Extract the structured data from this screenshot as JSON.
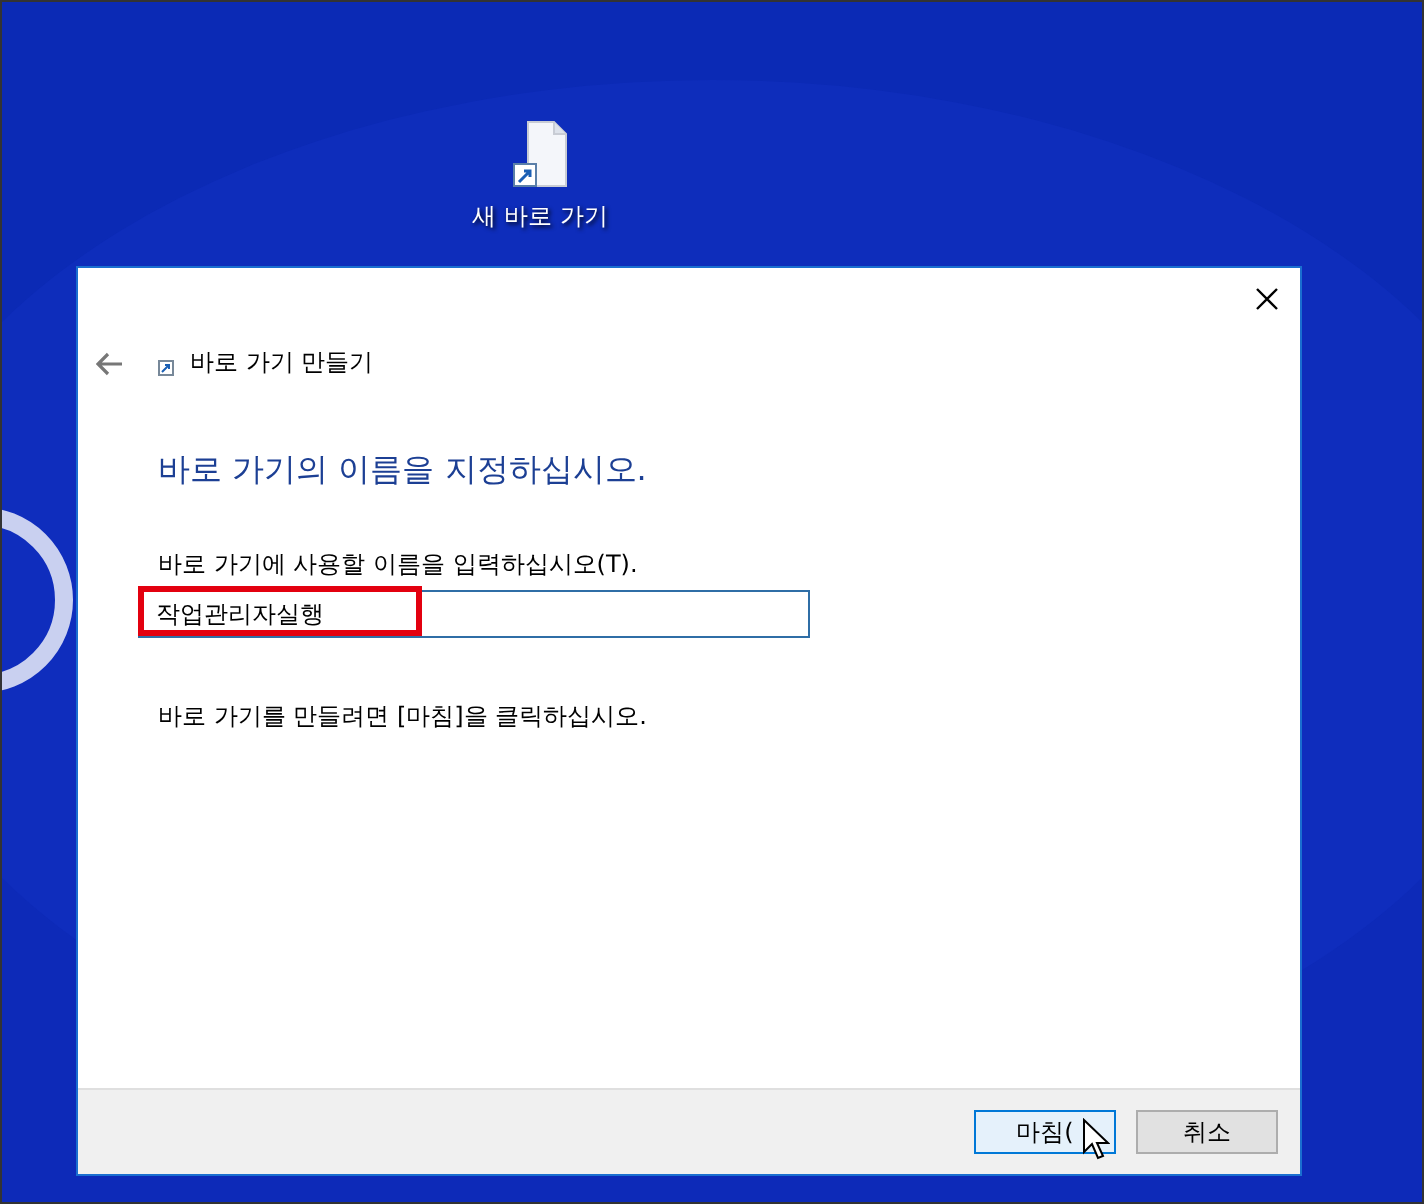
{
  "desktop_icons": [
    {
      "label": "새 바로 가기"
    }
  ],
  "dialog": {
    "title": "바로 가기 만들기",
    "heading": "바로 가기의 이름을 지정하십시오.",
    "name_field": {
      "label": "바로 가기에 사용할 이름을 입력하십시오(T).",
      "value": "작업관리자실행",
      "highlighted": true
    },
    "instruction": "바로 가기를 만들려면 [마침]을 클릭하십시오.",
    "buttons": [
      {
        "label": "마침(",
        "kind": "default"
      },
      {
        "label": "취소",
        "kind": "normal"
      }
    ]
  }
}
